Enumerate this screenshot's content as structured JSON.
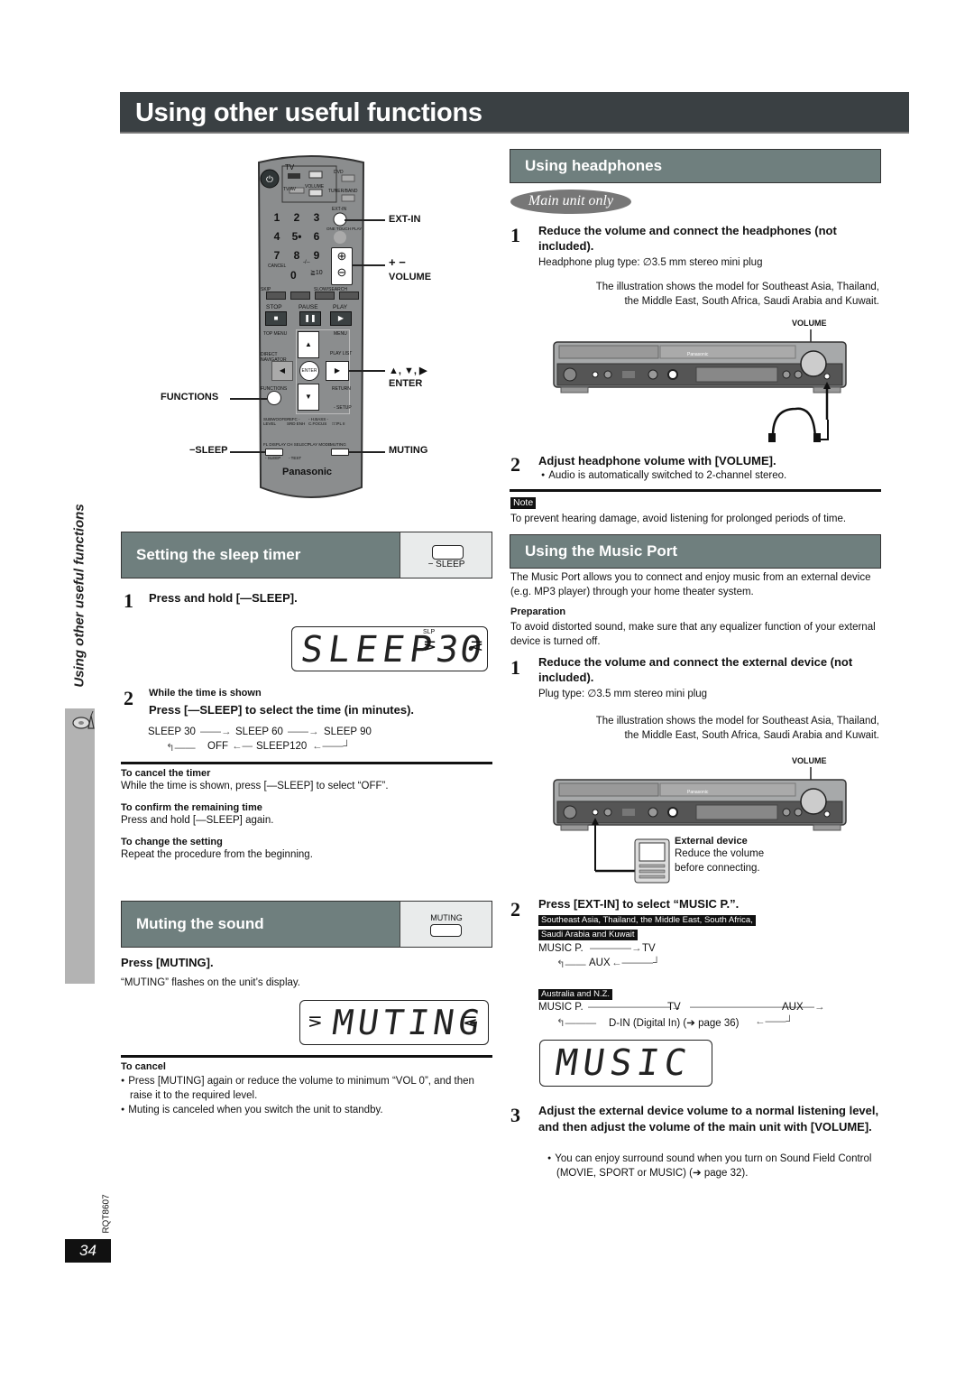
{
  "page": {
    "title": "Using other useful functions",
    "side_label": "Using other useful functions",
    "page_number": "34",
    "model_code": "RQT8607"
  },
  "remote": {
    "brand": "Panasonic",
    "callouts": {
      "ext_in": "EXT-IN",
      "volume_symbols": "+ −",
      "volume": "VOLUME",
      "arrows": "▲, ▼, ▶",
      "enter": "ENTER",
      "functions": "FUNCTIONS",
      "sleep": "−SLEEP",
      "muting": "MUTING"
    },
    "labels": {
      "tv": "TV",
      "tvav": "TV/AV",
      "volume_small": "VOLUME",
      "dvd": "DVD",
      "tuner_band": "TUNER/BAND",
      "ext_in_small": "EXT-IN",
      "one_touch": "ONE TOUCH PLAY",
      "cancel": "CANCEL",
      "skip": "SKIP",
      "slow_search": "SLOW/SEARCH",
      "stop": "STOP",
      "pause": "PAUSE",
      "play": "PLAY",
      "top_menu": "TOP MENU",
      "menu": "MENU",
      "direct_nav": "DIRECT NAVIGATOR",
      "play_list": "PLAY LIST",
      "functions_small": "FUNCTIONS",
      "return": "RETURN",
      "setup": "- SETUP",
      "enter_small": "ENTER",
      "subwoofer": "SUBWOOFER LEVEL",
      "sfc": "- SFC - SRD ENH",
      "hbass": "- H.BASS - C.FOCUS",
      "dpl": "□□PL II",
      "fl_display": "FL DISPLAY",
      "sleep_small": "- SLEEP",
      "ch_select": "CH SELECT",
      "test": "- TEST",
      "play_mode": "PLAY MODE",
      "muting_small": "MUTING"
    },
    "numbers": [
      "1",
      "2",
      "3",
      "4",
      "5•",
      "6",
      "7",
      "8",
      "9",
      "0"
    ],
    "ge10": "≧10",
    "dash": "-/--"
  },
  "headphones": {
    "heading": "Using headphones",
    "badge": "Main unit only",
    "step1": {
      "num": "1",
      "title": "Reduce the volume and connect the headphones (not included).",
      "plug": "Headphone plug type:  ∅3.5 mm stereo mini plug",
      "illustration_note_1": "The illustration shows the model for Southeast Asia, Thailand,",
      "illustration_note_2": "the Middle East, South Africa, Saudi Arabia and Kuwait.",
      "volume_label": "VOLUME",
      "unit_brand": "Panasonic"
    },
    "step2": {
      "num": "2",
      "title": "Adjust headphone volume with [VOLUME].",
      "bullet": "Audio is automatically switched to 2-channel stereo."
    },
    "note_label": "Note",
    "note_text": "To prevent hearing damage, avoid listening for prolonged periods of time."
  },
  "sleep": {
    "heading": "Setting the sleep timer",
    "icon_label": "− SLEEP",
    "step1": {
      "num": "1",
      "title": "Press and hold [—SLEEP]."
    },
    "lcd": {
      "text": "SLEEP",
      "value": "30",
      "indicator": "SLP"
    },
    "step2": {
      "num": "2",
      "pre": "While the time is shown",
      "title": "Press [—SLEEP] to select the time (in minutes)."
    },
    "flow": {
      "s30": "SLEEP 30",
      "s60": "SLEEP 60",
      "s90": "SLEEP 90",
      "off": "OFF",
      "s120": "SLEEP120"
    },
    "tips": [
      {
        "title": "To cancel the timer",
        "text": "While the time is shown, press [—SLEEP] to select “OFF”."
      },
      {
        "title": "To confirm the remaining time",
        "text": "Press and hold [—SLEEP] again."
      },
      {
        "title": "To change the setting",
        "text": "Repeat the procedure from the beginning."
      }
    ]
  },
  "muting": {
    "heading": "Muting the sound",
    "icon_label": "MUTING",
    "press": "Press [MUTING].",
    "desc": "“MUTING” flashes on the unit’s display.",
    "lcd": "MUTING",
    "cancel_title": "To cancel",
    "cancel_bullets": [
      "Press [MUTING] again or reduce the volume to minimum “VOL 0”, and then raise it to the required level.",
      "Muting is canceled when you switch the unit to standby."
    ]
  },
  "music_port": {
    "heading": "Using the Music Port",
    "intro": "The Music Port allows you to connect and enjoy music from an external device (e.g. MP3 player) through your home theater system.",
    "prep_title": "Preparation",
    "prep_text": "To avoid distorted sound, make sure that any equalizer function of your external device is turned off.",
    "step1": {
      "num": "1",
      "title": "Reduce the volume and connect the external device (not included).",
      "plug": "Plug type:  ∅3.5 mm stereo mini plug",
      "illustration_note_1": "The illustration shows the model for Southeast Asia, Thailand,",
      "illustration_note_2": "the Middle East, South Africa, Saudi Arabia and Kuwait.",
      "volume_label": "VOLUME",
      "unit_brand": "Panasonic",
      "ext_title": "External device",
      "ext_text_1": "Reduce the volume",
      "ext_text_2": "before connecting."
    },
    "step2": {
      "num": "2",
      "title": "Press [EXT-IN] to select “MUSIC P.”.",
      "region1_line1": "Southeast Asia, Thailand, the Middle East, South Africa,",
      "region1_line2": "Saudi Arabia and Kuwait",
      "flow1": {
        "music": "MUSIC P.",
        "tv": "TV",
        "aux": "AUX"
      },
      "region2": "Australia and N.Z.",
      "flow2": {
        "music": "MUSIC P.",
        "tv": "TV",
        "aux": "AUX",
        "din": "D-IN (Digital In) (➔ page 36)"
      }
    },
    "lcd": "MUSIC P",
    "step3": {
      "num": "3",
      "title": "Adjust the external device volume to a normal listening level, and then adjust the volume of the main unit with [VOLUME].",
      "bullet": "You can enjoy surround sound when you turn on Sound Field Control (MOVIE, SPORT or MUSIC) (➔ page 32)."
    }
  },
  "colors": {
    "title_bar": "#3a4043",
    "section_header": "#6f7f7e",
    "sidebar_tab": "#b3b3b3",
    "icon_box": "#e9ebeb"
  }
}
